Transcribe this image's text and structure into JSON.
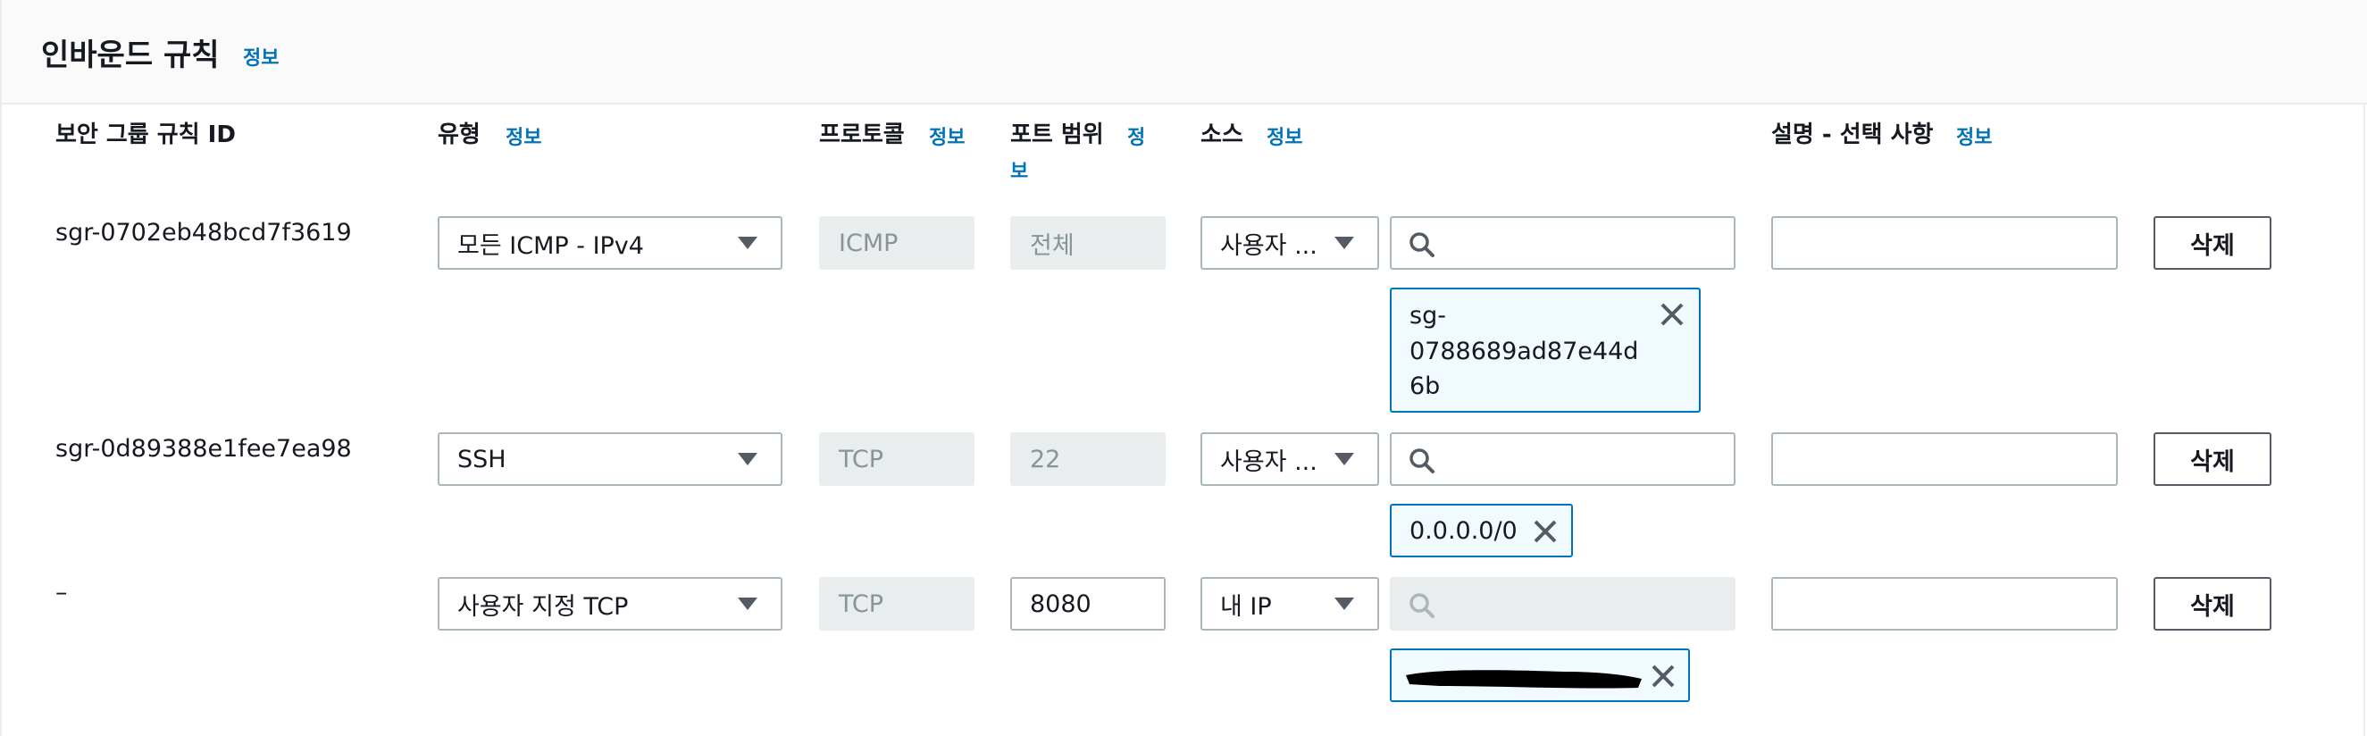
{
  "header": {
    "title": "인바운드 규칙",
    "info": "정보"
  },
  "columns": {
    "rule_id": "보안 그룹 규칙 ID",
    "type": "유형",
    "type_info": "정보",
    "protocol": "프로토콜",
    "protocol_info": "정보",
    "port_range": "포트 범위",
    "port_info_1": "정",
    "port_info_2": "보",
    "source": "소스",
    "source_info": "정보",
    "description": "설명 - 선택 사항",
    "description_info": "정보"
  },
  "rows": [
    {
      "rule_id": "sgr-0702eb48bcd7f3619",
      "type": "모든 ICMP - IPv4",
      "protocol": "ICMP",
      "port": "전체",
      "source_type": "사용자 ...",
      "source_search_placeholder": "",
      "token_lines": [
        "sg-",
        "0788689ad87e44d",
        "6b"
      ],
      "description": "",
      "delete_label": "삭제"
    },
    {
      "rule_id": "sgr-0d89388e1fee7ea98",
      "type": "SSH",
      "protocol": "TCP",
      "port": "22",
      "source_type": "사용자 ...",
      "source_search_placeholder": "",
      "token_lines": [
        "0.0.0.0/0"
      ],
      "description": "",
      "delete_label": "삭제"
    },
    {
      "rule_id": "–",
      "type": "사용자 지정 TCP",
      "protocol": "TCP",
      "port": "8080",
      "source_type": "내 IP",
      "source_search_placeholder": "",
      "token_lines": [],
      "token_redacted": true,
      "description": "",
      "delete_label": "삭제"
    }
  ],
  "colors": {
    "link": "#0073bb",
    "token_border": "#0073bb",
    "token_bg": "#f1faff"
  },
  "icons": {
    "search": "search-icon",
    "remove": "close-icon",
    "dropdown": "caret-down-icon"
  }
}
